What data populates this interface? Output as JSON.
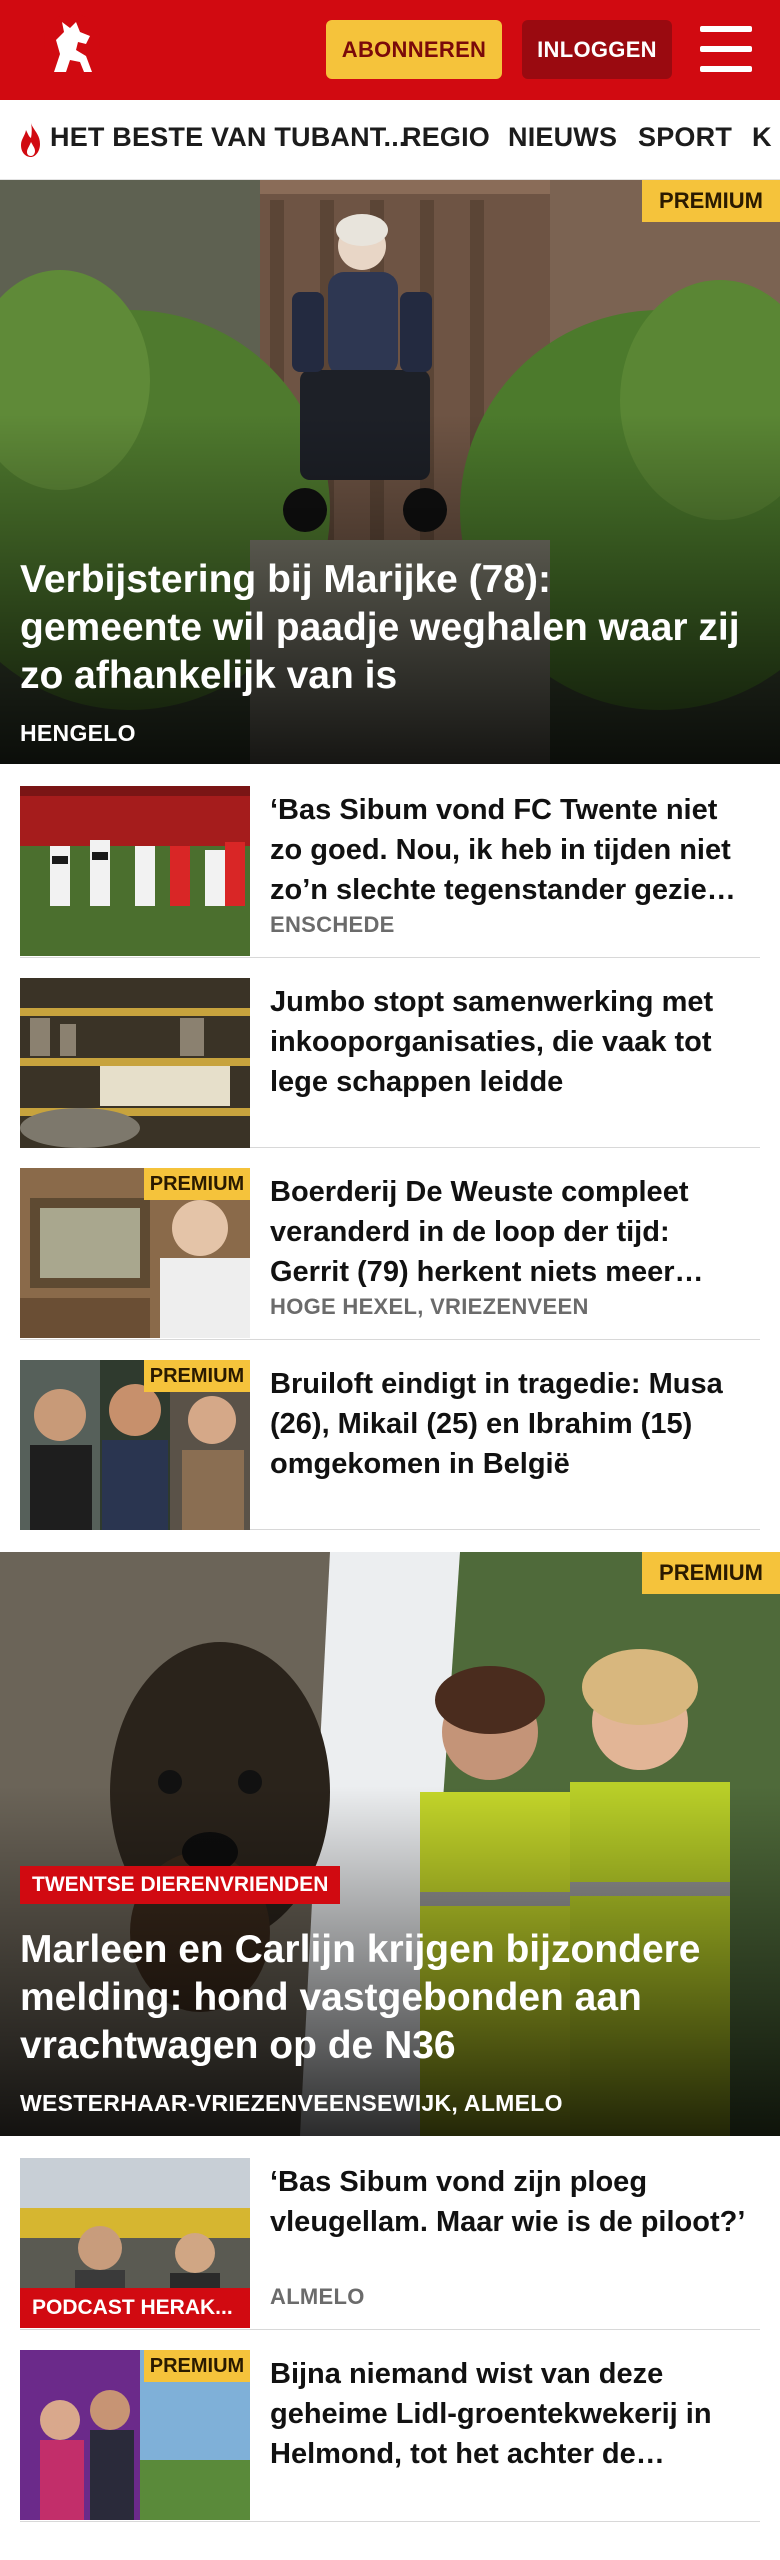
{
  "header": {
    "logo_icon": "tubantia-horse-logo-icon",
    "subscribe_label": "ABONNEREN",
    "login_label": "INLOGGEN",
    "menu_icon": "hamburger-menu-icon",
    "brand_color": "#d10a11",
    "accent_color": "#f5c33b"
  },
  "nav": {
    "items": [
      {
        "label": "HET BESTE VAN TUBANT..."
      },
      {
        "label": "REGIO"
      },
      {
        "label": "NIEUWS"
      },
      {
        "label": "SPORT"
      },
      {
        "label": "K"
      }
    ],
    "flame_icon": "flame-icon"
  },
  "hero1": {
    "badge": "PREMIUM",
    "title": "Verbijstering bij Marijke (78): gemeente wil paadje weghalen waar zij zo afhankelijk van is",
    "location": "HENGELO"
  },
  "articles1": [
    {
      "title": "‘Bas Sibum vond FC Twente niet zo goed. Nou, ik heb in tijden niet zo’n slechte tegenstander gezie…",
      "location": "ENSCHEDE",
      "badge": ""
    },
    {
      "title": "Jumbo stopt samenwerking met inkooporganisaties, die vaak tot lege schappen leidde",
      "location": "",
      "badge": ""
    },
    {
      "title": "Boerderij De Weuste compleet veranderd in de loop der tijd: Gerrit (79) herkent niets meer…",
      "location": "HOGE HEXEL, VRIEZENVEEN",
      "badge": "PREMIUM"
    },
    {
      "title": "Bruiloft eindigt in tragedie: Musa (26), Mikail (25) en Ibrahim (15) omgekomen in België",
      "location": "",
      "badge": "PREMIUM"
    }
  ],
  "hero2": {
    "badge": "PREMIUM",
    "tag": "TWENTSE DIERENVRIENDEN",
    "title": "Marleen en Carlijn krijgen bijzondere melding: hond vastgebonden aan vrachtwagen op de N36",
    "location": "WESTERHAAR-VRIEZENVEENSEWIJK, ALMELO"
  },
  "articles2": [
    {
      "title": "‘Bas Sibum vond zijn ploeg vleugellam. Maar wie is de piloot?’",
      "location": "ALMELO",
      "tag": "PODCAST HERAK..."
    },
    {
      "title": "Bijna niemand wist van deze geheime Lidl-groentekwekerij in Helmond, tot het achter de…",
      "location": "",
      "badge": "PREMIUM"
    }
  ]
}
